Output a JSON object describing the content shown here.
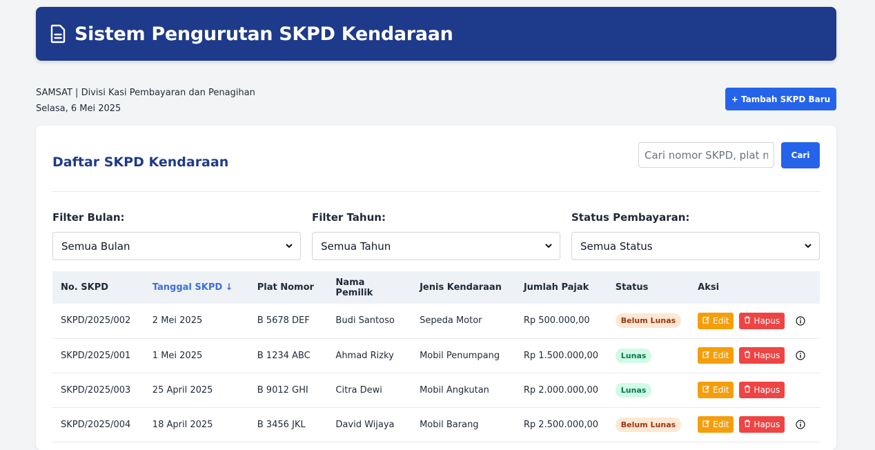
{
  "header": {
    "title": "Sistem Pengurutan SKPD Kendaraan",
    "icon": "document-icon"
  },
  "meta": {
    "office": "SAMSAT | Divisi Kasi Pembayaran dan Penagihan",
    "date": "Selasa, 6 Mei 2025"
  },
  "actions": {
    "add_label": "+ Tambah SKPD Baru"
  },
  "card": {
    "title": "Daftar SKPD Kendaraan",
    "search_placeholder": "Cari nomor SKPD, plat nomor...",
    "search_label": "Cari"
  },
  "filters": {
    "month": {
      "label": "Filter Bulan:",
      "value": "Semua Bulan"
    },
    "year": {
      "label": "Filter Tahun:",
      "value": "Semua Tahun"
    },
    "status": {
      "label": "Status Pembayaran:",
      "value": "Semua Status"
    }
  },
  "table": {
    "headers": [
      "No. SKPD",
      "Tanggal SKPD ↓",
      "Plat Nomor",
      "Nama Pemilik",
      "Jenis Kendaraan",
      "Jumlah Pajak",
      "Status",
      "Aksi"
    ],
    "edit_label": "Edit",
    "delete_label": "Hapus",
    "rows": [
      {
        "no": "SKPD/2025/002",
        "date": "2 Mei 2025",
        "plate": "B 5678 DEF",
        "owner": "Budi Santoso",
        "type": "Sepeda Motor",
        "tax": "Rp 500.000,00",
        "status": "Belum Lunas"
      },
      {
        "no": "SKPD/2025/001",
        "date": "1 Mei 2025",
        "plate": "B 1234 ABC",
        "owner": "Ahmad Rizky",
        "type": "Mobil Penumpang",
        "tax": "Rp 1.500.000,00",
        "status": "Lunas"
      },
      {
        "no": "SKPD/2025/003",
        "date": "25 April 2025",
        "plate": "B 9012 GHI",
        "owner": "Citra Dewi",
        "type": "Mobil Angkutan",
        "tax": "Rp 2.000.000,00",
        "status": "Lunas"
      },
      {
        "no": "SKPD/2025/004",
        "date": "18 April 2025",
        "plate": "B 3456 JKL",
        "owner": "David Wijaya",
        "type": "Mobil Barang",
        "tax": "Rp 2.500.000,00",
        "status": "Belum Lunas"
      }
    ]
  },
  "colors": {
    "header_bg": "#1e3a8a",
    "primary": "#2563eb",
    "edit": "#f59e0b",
    "delete": "#ef4444"
  }
}
